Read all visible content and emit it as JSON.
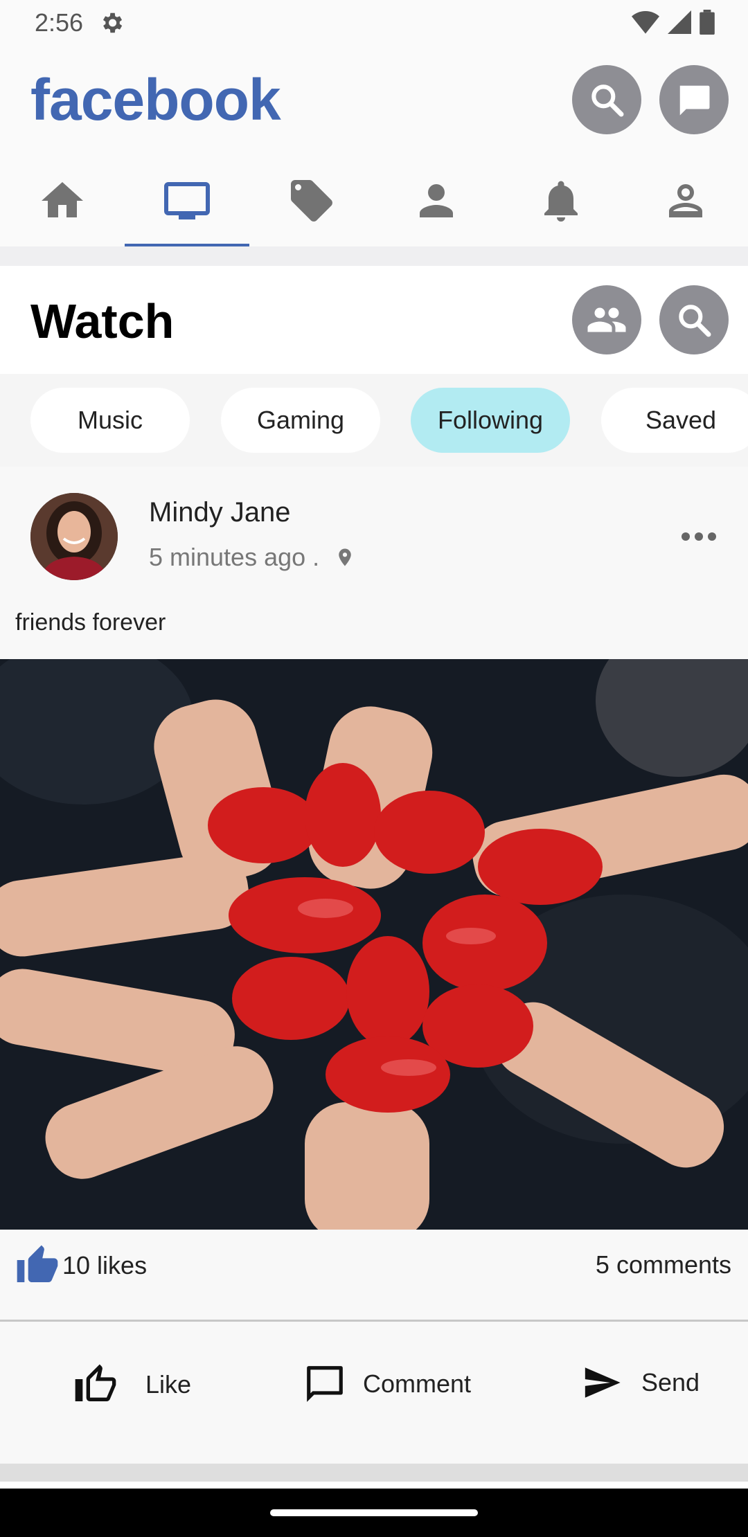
{
  "status_bar": {
    "time": "2:56"
  },
  "app_bar": {
    "logo": "facebook"
  },
  "nav_tabs": [
    {
      "icon": "home-icon"
    },
    {
      "icon": "tv-icon",
      "active": true
    },
    {
      "icon": "tag-icon"
    },
    {
      "icon": "person-icon"
    },
    {
      "icon": "bell-icon"
    },
    {
      "icon": "profile-icon"
    }
  ],
  "watch": {
    "title": "Watch"
  },
  "chips": [
    {
      "label": "Music"
    },
    {
      "label": "Gaming"
    },
    {
      "label": "Following",
      "active": true
    },
    {
      "label": "Saved"
    }
  ],
  "post": {
    "author": "Mindy Jane",
    "time": "5 minutes ago .",
    "caption": "friends forever",
    "likes": "10 likes",
    "comments": "5 comments",
    "actions": {
      "like": "Like",
      "comment": "Comment",
      "send": "Send"
    }
  },
  "colors": {
    "brand": "#4267b2",
    "chip_active": "#b2ebf2",
    "icon_gray": "#8e8e94"
  }
}
